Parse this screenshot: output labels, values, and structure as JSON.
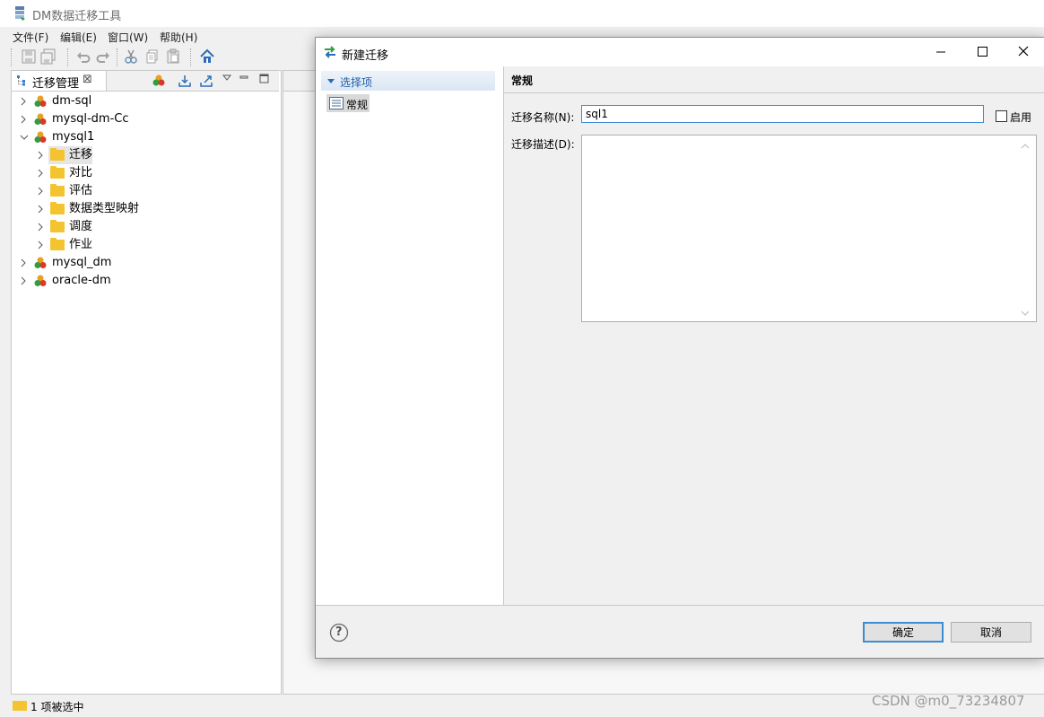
{
  "app": {
    "title": "DM数据迁移工具",
    "menu": [
      "文件(F)",
      "编辑(E)",
      "窗口(W)",
      "帮助(H)"
    ],
    "toolbar_icons": [
      "save-icon",
      "save-all-icon",
      "undo-icon",
      "redo-icon",
      "cut-icon",
      "copy-icon",
      "paste-icon",
      "home-icon"
    ]
  },
  "left_view": {
    "tab_label": "迁移管理",
    "tab_close": "⊠",
    "tree": [
      {
        "label": "dm-sql",
        "type": "project",
        "expanded": false
      },
      {
        "label": "mysql-dm-Cc",
        "type": "project",
        "expanded": false
      },
      {
        "label": "mysql1",
        "type": "project",
        "expanded": true
      },
      {
        "label": "迁移",
        "type": "folder",
        "selected": true
      },
      {
        "label": "对比",
        "type": "folder"
      },
      {
        "label": "评估",
        "type": "folder"
      },
      {
        "label": "数据类型映射",
        "type": "folder"
      },
      {
        "label": "调度",
        "type": "folder"
      },
      {
        "label": "作业",
        "type": "folder"
      },
      {
        "label": "mysql_dm",
        "type": "project",
        "expanded": false
      },
      {
        "label": "oracle-dm",
        "type": "project",
        "expanded": false
      }
    ]
  },
  "status_bar": {
    "text": "1 项被选中"
  },
  "watermark": "CSDN @m0_73234807",
  "dialog": {
    "title": "新建迁移",
    "section_label": "选择项",
    "nav_item": "常规",
    "right_header": "常规",
    "name_label": "迁移名称(N):",
    "name_value": "sql1",
    "enable_label": "启用",
    "desc_label": "迁移描述(D):",
    "ok_label": "确定",
    "cancel_label": "取消",
    "help_icon": "?"
  },
  "colors": {
    "accent": "#3c8cd4",
    "folder": "#f4c430",
    "section_header": "#dbe6f4"
  }
}
